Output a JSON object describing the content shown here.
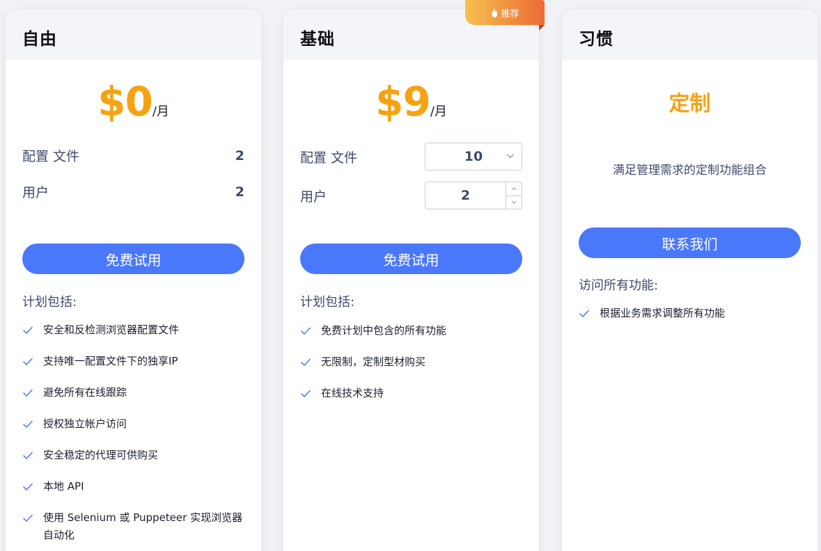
{
  "colors": {
    "accent": "#4a78fb",
    "price": "#f5a312",
    "badge_from": "#f6c04f",
    "badge_to": "#ec6b36"
  },
  "plans": {
    "free": {
      "title": "自由",
      "price": "$0",
      "unit": "/月",
      "profiles_label": "配置 文件",
      "profiles_value": "2",
      "users_label": "用户",
      "users_value": "2",
      "cta": "免费试用",
      "includes_label": "计划包括:",
      "features": [
        "安全和反检测浏览器配置文件",
        "支持唯一配置文件下的独享IP",
        "避免所有在线跟踪",
        "授权独立帐户访问",
        "安全稳定的代理可供购买",
        "本地 API",
        "使用 Selenium 或 Puppeteer 实现浏览器自动化"
      ]
    },
    "basic": {
      "title": "基础",
      "badge": "推荐",
      "badge_icon": "flame-icon",
      "price": "$9",
      "unit": "/月",
      "profiles_label": "配置 文件",
      "profiles_select": "10",
      "users_label": "用户",
      "users_value": "2",
      "cta": "免费试用",
      "includes_label": "计划包括:",
      "features": [
        "免费计划中包含的所有功能",
        "无限制，定制型材购买",
        "在线技术支持"
      ]
    },
    "custom": {
      "title": "习惯",
      "headline": "定制",
      "description": "满足管理需求的定制功能组合",
      "cta": "联系我们",
      "includes_label": "访问所有功能:",
      "features": [
        "根据业务需求调整所有功能"
      ]
    }
  }
}
